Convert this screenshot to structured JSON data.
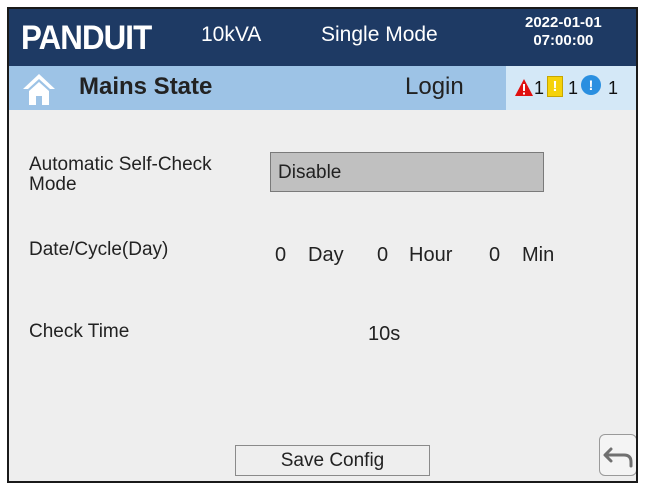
{
  "header": {
    "logo": "PANDUIT",
    "power": "10kVA",
    "mode": "Single Mode",
    "date": "2022-01-01",
    "time": "07:00:00"
  },
  "status": {
    "state": "Mains State",
    "login": "Login",
    "alarms": {
      "critical_count": "1",
      "warning_count": "1",
      "info_count": "1",
      "warning_glyph": "!",
      "info_glyph": "!"
    }
  },
  "form": {
    "self_check_label_line1": "Automatic Self-Check",
    "self_check_label_line2": "Mode",
    "self_check_value": "Disable",
    "date_cycle_label": "Date/Cycle(Day)",
    "day_value": "0",
    "day_unit": "Day",
    "hour_value": "0",
    "hour_unit": "Hour",
    "min_value": "0",
    "min_unit": "Min",
    "check_time_label": "Check Time",
    "check_time_value": "10s"
  },
  "footer": {
    "save_label": "Save Config"
  },
  "colors": {
    "header_bg": "#1e3a64",
    "status_bg": "#9dc3e6",
    "critical": "#e01010",
    "warning": "#f5d20a",
    "info": "#2a8fe0"
  },
  "icons": {
    "home": "home-icon",
    "critical": "warning-triangle-icon",
    "warning": "warning-square-icon",
    "info": "info-circle-icon",
    "back": "back-arrow-icon"
  }
}
